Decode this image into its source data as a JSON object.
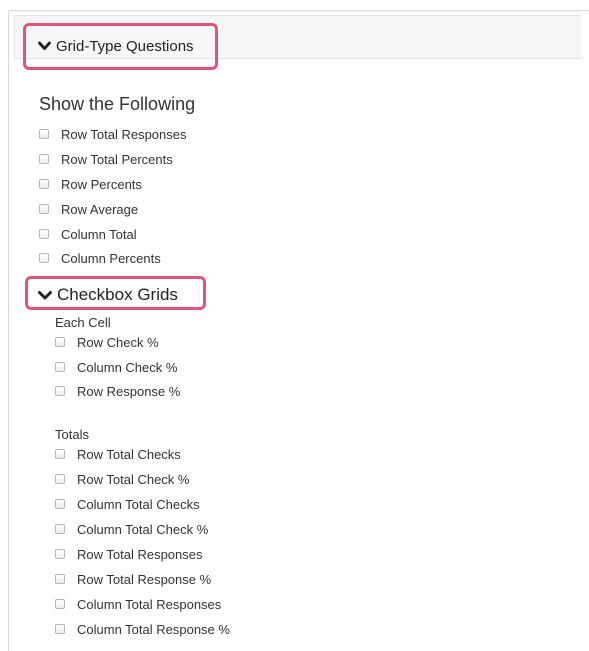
{
  "grid_type": {
    "toggle_label": "Grid-Type Questions",
    "section_title": "Show the Following",
    "options": [
      "Row Total Responses",
      "Row Total Percents",
      "Row Percents",
      "Row Average",
      "Column Total",
      "Column Percents"
    ]
  },
  "checkbox_grids": {
    "toggle_label": "Checkbox Grids",
    "each_cell": {
      "label": "Each Cell",
      "options": [
        "Row Check %",
        "Column Check %",
        "Row Response %"
      ]
    },
    "totals": {
      "label": "Totals",
      "options": [
        "Row Total Checks",
        "Row Total Check %",
        "Column Total Checks",
        "Column Total Check %",
        "Row Total Responses",
        "Row Total Response %",
        "Column Total Responses",
        "Column Total Response %"
      ]
    }
  },
  "icons": {
    "expand": "chevron-down-icon",
    "checkbox": "checkbox-unchecked"
  },
  "colors": {
    "highlight": "#e0567a",
    "header_bg": "#f6f6f6"
  }
}
